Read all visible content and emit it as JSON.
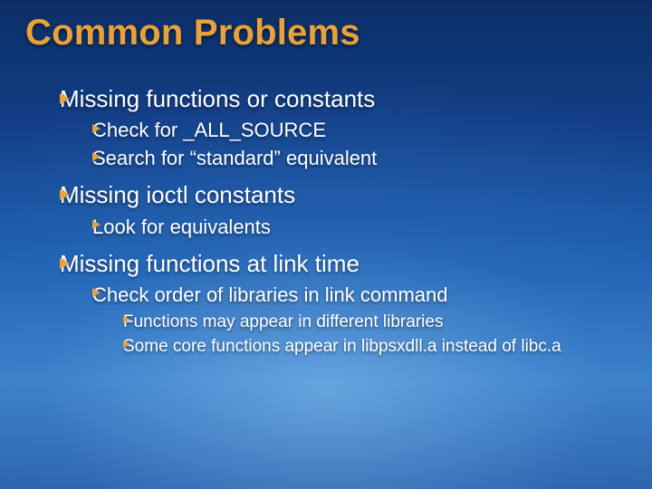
{
  "title": "Common Problems",
  "bullets": [
    {
      "text": "Missing functions or constants",
      "children": [
        {
          "text": "Check for _ALL_SOURCE"
        },
        {
          "text": "Search for “standard” equivalent"
        }
      ]
    },
    {
      "text": "Missing ioctl constants",
      "children": [
        {
          "text": "Look for equivalents"
        }
      ]
    },
    {
      "text": "Missing functions at link time",
      "children": [
        {
          "text": "Check order of libraries in link command",
          "children": [
            {
              "text": "Functions may appear in different libraries"
            },
            {
              "text": "Some core functions appear in libpsxdll.a instead of libc.a"
            }
          ]
        }
      ]
    }
  ]
}
